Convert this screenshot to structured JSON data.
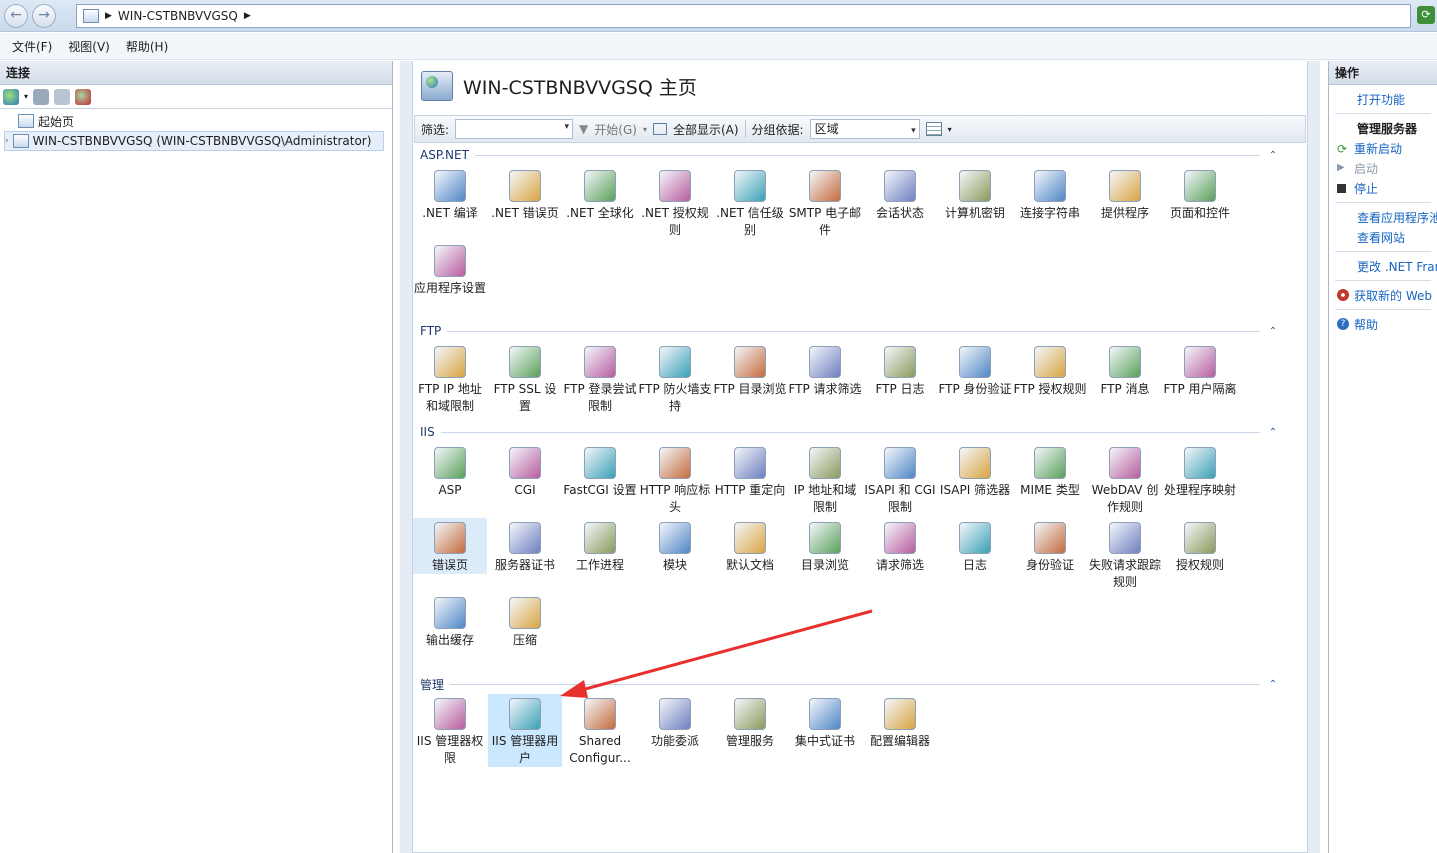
{
  "address": {
    "host": "WIN-CSTBNBVVGSQ"
  },
  "menu": [
    "文件(F)",
    "视图(V)",
    "帮助(H)"
  ],
  "left": {
    "title": "连接",
    "tree": [
      "起始页",
      "WIN-CSTBNBVVGSQ (WIN-CSTBNBVVGSQ\\Administrator)"
    ]
  },
  "page": {
    "title": "WIN-CSTBNBVVGSQ 主页"
  },
  "filter": {
    "label": "筛选:",
    "start": "开始(G)",
    "showall": "全部显示(A)",
    "groupby": "分组依据:",
    "groupval": "区域"
  },
  "groups": [
    {
      "name": "ASP.NET",
      "items": [
        ".NET 编译",
        ".NET 错误页",
        ".NET 全球化",
        ".NET 授权规则",
        ".NET 信任级别",
        "SMTP 电子邮件",
        "会话状态",
        "计算机密钥",
        "连接字符串",
        "提供程序",
        "页面和控件",
        "应用程序设置"
      ]
    },
    {
      "name": "FTP",
      "items": [
        "FTP IP 地址和域限制",
        "FTP SSL 设置",
        "FTP 登录尝试限制",
        "FTP 防火墙支持",
        "FTP 目录浏览",
        "FTP 请求筛选",
        "FTP 日志",
        "FTP 身份验证",
        "FTP 授权规则",
        "FTP 消息",
        "FTP 用户隔离"
      ]
    },
    {
      "name": "IIS",
      "items": [
        "ASP",
        "CGI",
        "FastCGI 设置",
        "HTTP 响应标头",
        "HTTP 重定向",
        "IP 地址和域限制",
        "ISAPI 和 CGI 限制",
        "ISAPI 筛选器",
        "MIME 类型",
        "WebDAV 创作规则",
        "处理程序映射",
        "错误页",
        "服务器证书",
        "工作进程",
        "模块",
        "默认文档",
        "目录浏览",
        "请求筛选",
        "日志",
        "身份验证",
        "失败请求跟踪规则",
        "授权规则",
        "输出缓存",
        "压缩"
      ]
    },
    {
      "name": "管理",
      "items": [
        "IIS 管理器权限",
        "IIS 管理器用户",
        "Shared Configur...",
        "功能委派",
        "管理服务",
        "集中式证书",
        "配置编辑器"
      ]
    }
  ],
  "right": {
    "title": "操作",
    "actions": [
      "打开功能",
      "管理服务器",
      "重新启动",
      "启动",
      "停止",
      "查看应用程序池",
      "查看网站",
      "更改 .NET Fran",
      "获取新的 Web",
      "帮助"
    ]
  },
  "colors": {
    "accent": "#1565c0",
    "selection": "#cce8ff",
    "arrow": "#e8312f"
  }
}
